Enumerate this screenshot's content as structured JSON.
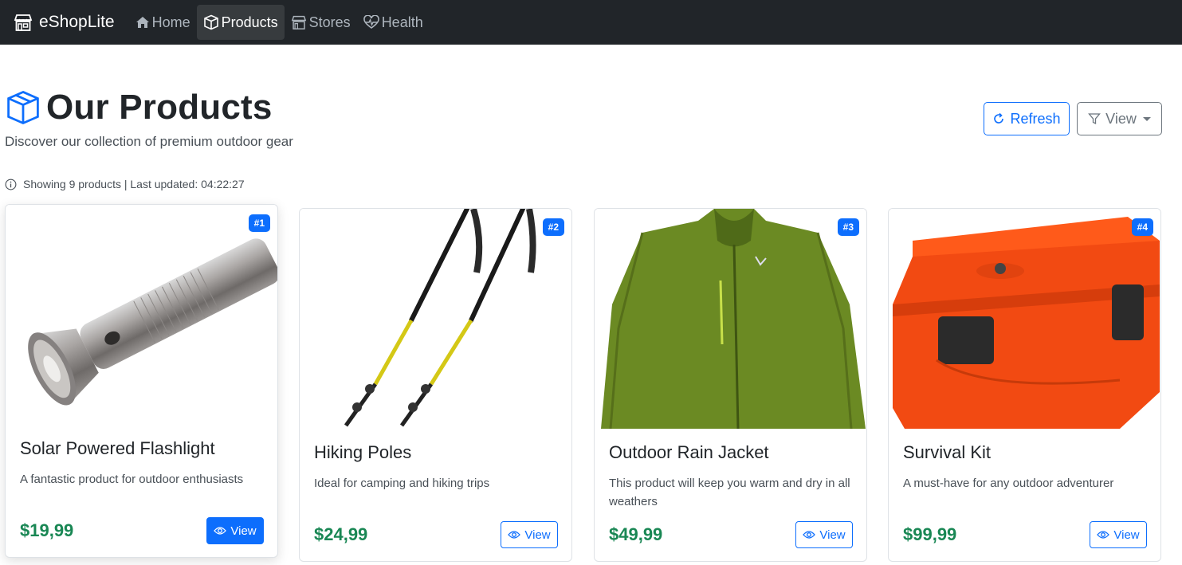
{
  "navbar": {
    "brand": "eShopLite",
    "items": [
      {
        "label": "Home",
        "icon": "house-icon",
        "active": false
      },
      {
        "label": "Products",
        "icon": "box-icon",
        "active": true
      },
      {
        "label": "Stores",
        "icon": "shop-icon",
        "active": false
      },
      {
        "label": "Health",
        "icon": "heart-pulse-icon",
        "active": false
      }
    ]
  },
  "header": {
    "title": "Our Products",
    "subtitle": "Discover our collection of premium outdoor gear",
    "refresh_label": "Refresh",
    "view_label": "View"
  },
  "info": {
    "text": "Showing 9 products | Last updated: 04:22:27"
  },
  "products": [
    {
      "badge": "#1",
      "name": "Solar Powered Flashlight",
      "description": "A fantastic product for outdoor enthusiasts",
      "price": "$19,99",
      "button": "View",
      "image": "flashlight"
    },
    {
      "badge": "#2",
      "name": "Hiking Poles",
      "description": "Ideal for camping and hiking trips",
      "price": "$24,99",
      "button": "View",
      "image": "hiking-poles"
    },
    {
      "badge": "#3",
      "name": "Outdoor Rain Jacket",
      "description": "This product will keep you warm and dry in all weathers",
      "price": "$49,99",
      "button": "View",
      "image": "rain-jacket"
    },
    {
      "badge": "#4",
      "name": "Survival Kit",
      "description": "A must-have for any outdoor adventurer",
      "price": "$99,99",
      "button": "View",
      "image": "survival-kit"
    }
  ],
  "colors": {
    "navbar_bg": "#212529",
    "primary": "#0d6efd",
    "price_green": "#198754",
    "secondary": "#6c757d"
  }
}
